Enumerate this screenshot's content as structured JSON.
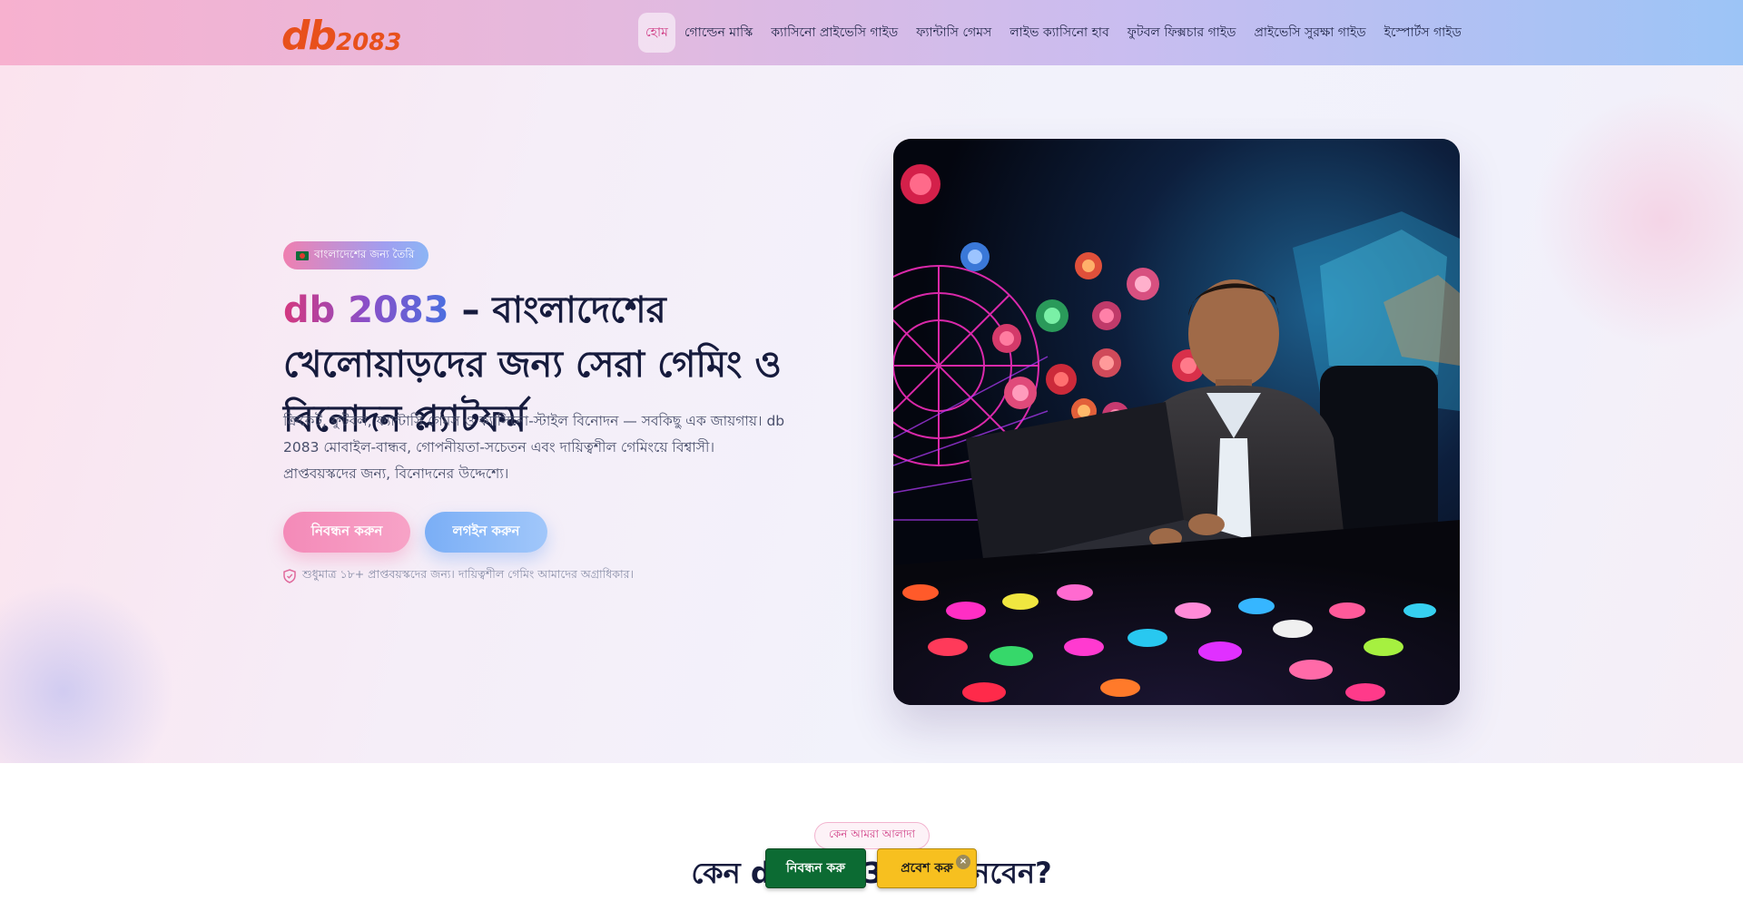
{
  "header": {
    "logo": {
      "primary": "db",
      "secondary": "2083"
    },
    "nav": [
      {
        "label": "হোম",
        "active": true
      },
      {
        "label": "গোল্ডেন মাস্কি",
        "active": false
      },
      {
        "label": "ক্যাসিনো প্রাইভেসি গাইড",
        "active": false
      },
      {
        "label": "ফ্যান্টাসি গেমস",
        "active": false
      },
      {
        "label": "লাইভ ক্যাসিনো হাব",
        "active": false
      },
      {
        "label": "ফুটবল ফিক্সচার গাইড",
        "active": false
      },
      {
        "label": "প্রাইভেসি সুরক্ষা গাইড",
        "active": false
      },
      {
        "label": "ইস্পোর্টস গাইড",
        "active": false
      }
    ]
  },
  "hero": {
    "badge": "বাংলাদেশের জন্য তৈরি",
    "title_brand": "db 2083",
    "title_rest": " – বাংলাদেশের খেলোয়াড়দের জন্য সেরা গেমিং ও বিনোদন প্ল্যাটফর্ম",
    "description": "ক্রিকেট, ফুটবল, ফ্যান্টাসি গেমস ও ক্যাসিনো-স্টাইল বিনোদন — সবকিছু এক জায়গায়। db 2083 মোবাইল-বান্ধব, গোপনীয়তা-সচেতন এবং দায়িত্বশীল গেমিংয়ে বিশ্বাসী। প্রাপ্তবয়স্কদের জন্য, বিনোদনের উদ্দেশ্যে।",
    "register_button": "নিবন্ধন করুন",
    "login_button": "লগইন করুন",
    "age_notice": "শুধুমাত্র ১৮+ প্রাপ্তবয়স্কদের জন্য। দায়িত্বশীল গেমিং আমাদের অগ্রাধিকার।"
  },
  "section2": {
    "pill": "কেন আমরা আলাদা",
    "title": "কেন db 2083 বেছে নেবেন?"
  },
  "sticky_cta": {
    "register": "নিবন্ধন করু",
    "login": "প্রবেশ করু",
    "close": "×"
  },
  "colors": {
    "accent_pink": "#d03d85",
    "accent_blue": "#4a6fe0",
    "logo_orange": "#e8501c",
    "cta_green": "#0c6b33",
    "cta_yellow": "#f7c01f"
  }
}
